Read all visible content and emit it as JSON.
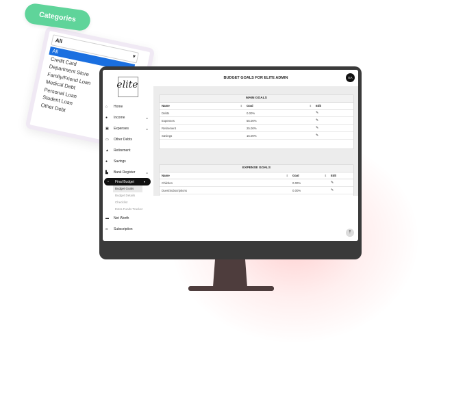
{
  "categories": {
    "pill_label": "Categories",
    "select_value": "All",
    "options": [
      "All",
      "Credit Card",
      "Department Store",
      "Family/Friend Loan",
      "Medical Debt",
      "Personal Loan",
      "Student Loan",
      "Other Debt"
    ],
    "active_index": 0
  },
  "app": {
    "logo_text": "elite",
    "page_title": "BUDGET GOALS FOR ELITE ADMIN",
    "avatar_initials": "EA"
  },
  "sidebar": {
    "items": [
      {
        "label": "Home",
        "icon": "home-icon",
        "glyph": "⌂"
      },
      {
        "label": "Income",
        "icon": "dollar-icon",
        "glyph": "●",
        "arrow": "▸"
      },
      {
        "label": "Expenses",
        "icon": "cart-icon",
        "glyph": "▣",
        "arrow": "▸"
      },
      {
        "label": "Other Debts",
        "icon": "card-icon",
        "glyph": "▭"
      },
      {
        "label": "Retirement",
        "icon": "house-icon",
        "glyph": "▲"
      },
      {
        "label": "Savings",
        "icon": "piggy-icon",
        "glyph": "●"
      },
      {
        "label": "Bank Register",
        "icon": "bank-icon",
        "glyph": "▙",
        "arrow": "▸"
      },
      {
        "label": "Final Budget",
        "icon": "chart-icon",
        "glyph": "◔",
        "arrow": "▾"
      },
      {
        "label": "Net Worth",
        "icon": "wallet-icon",
        "glyph": "▬"
      },
      {
        "label": "Subscription",
        "icon": "link-icon",
        "glyph": "∞"
      }
    ],
    "final_budget_sub": [
      "Budget Goals",
      "Budget Details",
      "Checklist",
      "Extra Funds Tracker"
    ]
  },
  "main_goals": {
    "title": "MAIN GOALS",
    "headers": [
      "Name",
      "Goal",
      "Edit"
    ],
    "rows": [
      {
        "name": "Debts",
        "goal": "0.00%"
      },
      {
        "name": "Expenses",
        "goal": "55.00%"
      },
      {
        "name": "Retirement",
        "goal": "25.00%"
      },
      {
        "name": "Savings",
        "goal": "15.00%"
      }
    ]
  },
  "expense_goals": {
    "title": "EXPENSE GOALS",
    "headers": [
      "Name",
      "Goal",
      "Edit"
    ],
    "rows": [
      {
        "name": "Children",
        "goal": "0.00%"
      },
      {
        "name": "Dues/Subscriptions",
        "goal": "0.00%"
      }
    ]
  },
  "colors": {
    "accent_green": "#5fd49a",
    "select_blue": "#1a6fe0",
    "monitor": "#3a3a3a",
    "stand": "#4e3d3d"
  }
}
